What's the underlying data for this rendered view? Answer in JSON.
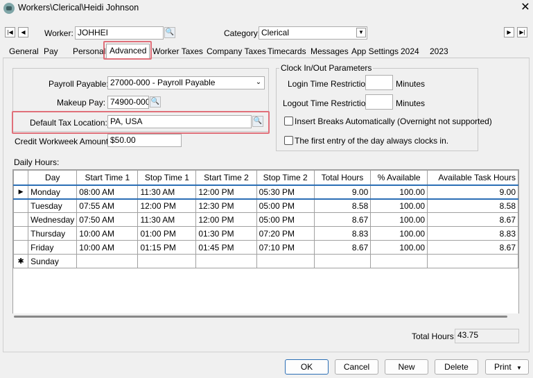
{
  "window": {
    "title": "Workers\\Clerical\\Heidi Johnson",
    "close": "✕"
  },
  "toolbar": {
    "first": "|◀",
    "prev": "◀",
    "next": "▶",
    "last": "▶|",
    "worker_label": "Worker:",
    "worker_value": "JOHHEI",
    "category_label": "Category:",
    "category_value": "Clerical"
  },
  "tabs": [
    "General",
    "Pay",
    "Personal",
    "Advanced",
    "Worker Taxes",
    "Company Taxes",
    "Timecards",
    "Messages",
    "App Settings",
    "2024",
    "2023"
  ],
  "active_tab": "Advanced",
  "advanced": {
    "payroll_payable_label": "Payroll Payable:",
    "payroll_payable_value": "27000-000 - Payroll Payable",
    "makeup_pay_label": "Makeup Pay:",
    "makeup_pay_value": "74900-000",
    "default_tax_location_label": "Default Tax Location:",
    "default_tax_location_value": "PA, USA",
    "credit_workweek_label": "Credit Workweek Amount:",
    "credit_workweek_value": "$50.00"
  },
  "clock": {
    "group_title": "Clock In/Out Parameters",
    "login_label": "Login Time Restriction:",
    "login_value": "",
    "login_unit": "Minutes",
    "logout_label": "Logout Time Restriction:",
    "logout_value": "",
    "logout_unit": "Minutes",
    "insert_breaks_label": "Insert Breaks Automatically (Overnight not supported)",
    "insert_breaks_checked": false,
    "first_entry_label": "The first entry of the day always clocks in.",
    "first_entry_checked": false
  },
  "daily_hours": {
    "label": "Daily Hours:",
    "columns": [
      "Day",
      "Start Time 1",
      "Stop Time 1",
      "Start Time 2",
      "Stop Time 2",
      "Total Hours",
      "% Available",
      "Available Task Hours"
    ],
    "rows": [
      [
        "Monday",
        "08:00 AM",
        "11:30 AM",
        "12:00 PM",
        "05:30 PM",
        "9.00",
        "100.00",
        "9.00"
      ],
      [
        "Tuesday",
        "07:55 AM",
        "12:00 PM",
        "12:30 PM",
        "05:00 PM",
        "8.58",
        "100.00",
        "8.58"
      ],
      [
        "Wednesday",
        "07:50 AM",
        "11:30 AM",
        "12:00 PM",
        "05:00 PM",
        "8.67",
        "100.00",
        "8.67"
      ],
      [
        "Thursday",
        "10:00 AM",
        "01:00 PM",
        "01:30 PM",
        "07:20 PM",
        "8.83",
        "100.00",
        "8.83"
      ],
      [
        "Friday",
        "10:00 AM",
        "01:15 PM",
        "01:45 PM",
        "07:10 PM",
        "8.67",
        "100.00",
        "8.67"
      ],
      [
        "Sunday",
        "",
        "",
        "",
        "",
        "",
        "",
        ""
      ]
    ],
    "current_row_marker": "▶",
    "new_row_marker": "✱",
    "total_label": "Total Hours:",
    "total_value": "43.75"
  },
  "buttons": {
    "ok": "OK",
    "cancel": "Cancel",
    "new": "New",
    "delete": "Delete",
    "print": "Print"
  },
  "colors": {
    "highlight": "#e0707a",
    "selection": "#2a6eb5"
  }
}
